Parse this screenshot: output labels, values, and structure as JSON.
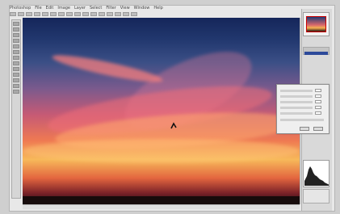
{
  "menubar": {
    "items": [
      "Photoshop",
      "File",
      "Edit",
      "Image",
      "Layer",
      "Select",
      "Filter",
      "View",
      "Window",
      "Help"
    ]
  },
  "colors": {
    "sky_top": "#15265a",
    "cloud_pink": "#ef7a52",
    "horizon_dark": "#1f0c0f",
    "navigator_outline": "#cc0000",
    "selected_tab": "#2d4a9a"
  },
  "icons": {
    "tools": [
      "move-tool-icon",
      "marquee-tool-icon",
      "lasso-tool-icon",
      "crop-tool-icon",
      "brush-tool-icon",
      "stamp-tool-icon",
      "eraser-tool-icon",
      "gradient-tool-icon",
      "dodge-tool-icon",
      "pen-tool-icon",
      "type-tool-icon",
      "hand-tool-icon",
      "zoom-tool-icon"
    ]
  }
}
